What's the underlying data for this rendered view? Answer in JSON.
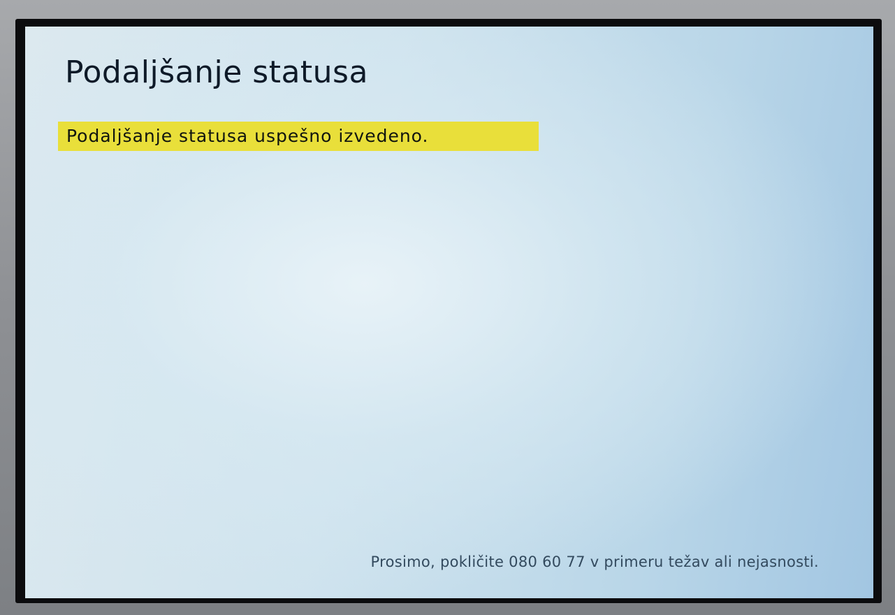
{
  "screen": {
    "title": "Podaljšanje statusa",
    "message": "Podaljšanje statusa uspešno izvedeno.",
    "footer": "Prosimo, pokličite 080 60 77 v primeru težav ali nejasnosti."
  },
  "colors": {
    "banner": "#e9df3a",
    "screen_background": "#cfe3ee",
    "title_text": "#0e1a28",
    "footer_text": "#334a5e"
  }
}
